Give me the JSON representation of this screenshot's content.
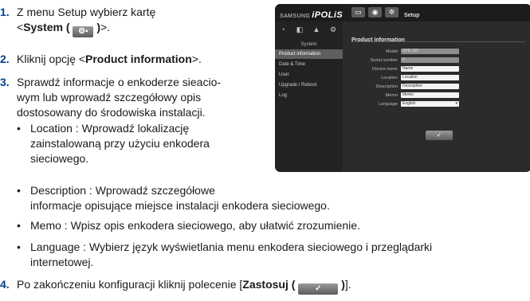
{
  "steps": [
    {
      "num": "1.",
      "line1": "Z menu Setup wybierz kartę",
      "line2_pre": "<",
      "line2_bold": "System (",
      "line2_bold_close": ")",
      "line2_post": ">."
    },
    {
      "num": "2.",
      "pre": "Kliknij opcję <",
      "bold": "Product information",
      "post": ">."
    },
    {
      "num": "3.",
      "lines": [
        "Sprawdź informacje o enkoderze sieacio-",
        "wym lub wprowadź szczegółowy opis",
        "dostosowany do środowiska instalacji."
      ],
      "bullets": [
        {
          "lines": [
            "Location : Wprowadź lokalizację",
            "zainstalowaną przy użyciu enkodera",
            "sieciowego."
          ]
        },
        {
          "lines": [
            "Description : Wprowadź szczegółowe",
            "informacje opisujące miejsce instalacji enkodera sieciowego."
          ]
        },
        {
          "lines": [
            "Memo : Wpisz opis enkodera sieciowego, aby ułatwić zrozumienie."
          ]
        },
        {
          "lines": [
            "Language : Wybierz język wyświetlania menu enkodera sieciowego i przeglądarki",
            "internetowej."
          ]
        }
      ]
    },
    {
      "num": "4.",
      "pre": "Po zakończeniu konfiguracji kliknij polecenie [",
      "bold": "Zastosuj (",
      "bold_close": ")",
      "post": "]."
    }
  ],
  "screenshot": {
    "brand_small": "SAMSUNG",
    "brand_big": "iPOLiS",
    "setup_title": "Setup",
    "top_icons": [
      "monitor-icon",
      "camera-icon",
      "gear-icon"
    ],
    "side_icons": [
      "camera-icon",
      "network-icon",
      "bell-icon",
      "system-icon"
    ],
    "system_label": "System",
    "menu_items": [
      "Product information",
      "Date & Time",
      "User",
      "Upgrade / Reboot",
      "Log"
    ],
    "active_index": 0,
    "content_title": "Product information",
    "fields": [
      {
        "label": "Model",
        "value": "SPE-100",
        "readonly": true
      },
      {
        "label": "Serial number",
        "value": "0",
        "readonly": true
      },
      {
        "label": "Device name",
        "value": "Name",
        "readonly": false
      },
      {
        "label": "Location",
        "value": "Location",
        "readonly": false
      },
      {
        "label": "Description",
        "value": "Description",
        "readonly": false
      },
      {
        "label": "Memo",
        "value": "Memo",
        "readonly": false
      },
      {
        "label": "Language",
        "value": "English",
        "readonly": false,
        "dropdown": true
      }
    ],
    "apply_icon": "checkmark-icon"
  }
}
